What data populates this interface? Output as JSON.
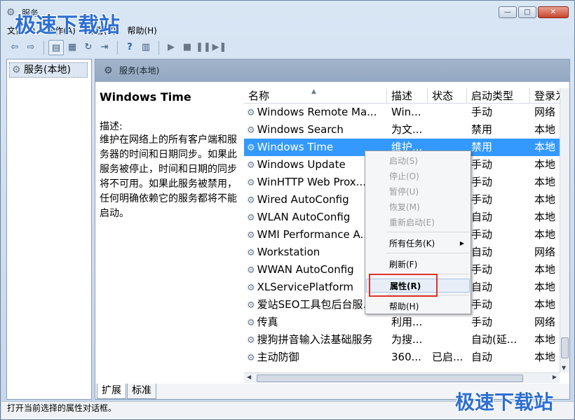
{
  "window": {
    "title": "服务",
    "app_icon": "⚙",
    "buttons": [
      "—",
      "□",
      "✕"
    ]
  },
  "menubar": [
    "文件(F)",
    "操作(A)",
    "查看(V)",
    "帮助(H)"
  ],
  "toolbar": {
    "icons": [
      "back-arrow-icon",
      "forward-arrow-icon",
      "show-hide-console-tree-icon",
      "properties-icon",
      "refresh-icon",
      "export-list-icon",
      "help-icon",
      "view-icon",
      "start-service-icon",
      "stop-service-icon",
      "pause-service-icon",
      "restart-service-icon"
    ]
  },
  "tree": {
    "item": "服务(本地)"
  },
  "pane": {
    "header": "服务(本地)"
  },
  "description": {
    "service_title": "Windows Time",
    "label": "描述:",
    "text": "维护在网络上的所有客户端和服务器的时间和日期同步。如果此服务被停止，时间和日期的同步将不可用。如果此服务被禁用，任何明确依赖它的服务都将不能启动。"
  },
  "columns": [
    "名称",
    "描述",
    "状态",
    "启动类型",
    "登录为"
  ],
  "rows": [
    {
      "name": "Windows Remote Ma...",
      "desc": "Win...",
      "status": "",
      "start": "手动",
      "logon": "网络"
    },
    {
      "name": "Windows Search",
      "desc": "为文...",
      "status": "",
      "start": "禁用",
      "logon": "本地"
    },
    {
      "name": "Windows Time",
      "desc": "维护...",
      "status": "",
      "start": "禁用",
      "logon": "本地"
    },
    {
      "name": "Windows Update",
      "desc": "",
      "status": "",
      "start": "手动",
      "logon": "本地"
    },
    {
      "name": "WinHTTP Web Prox...",
      "desc": "",
      "status": "",
      "start": "手动",
      "logon": "本地"
    },
    {
      "name": "Wired AutoConfig",
      "desc": "",
      "status": "",
      "start": "手动",
      "logon": "本地"
    },
    {
      "name": "WLAN AutoConfig",
      "desc": "",
      "status": "",
      "start": "自动",
      "logon": "本地"
    },
    {
      "name": "WMI Performance A...",
      "desc": "",
      "status": "",
      "start": "手动",
      "logon": "本地"
    },
    {
      "name": "Workstation",
      "desc": "",
      "status": "",
      "start": "自动",
      "logon": "网络"
    },
    {
      "name": "WWAN AutoConfig",
      "desc": "",
      "status": "",
      "start": "手动",
      "logon": "本地"
    },
    {
      "name": "XLServicePlatform",
      "desc": "",
      "status": "",
      "start": "自动",
      "logon": "本地"
    },
    {
      "name": "爱站SEO工具包后台服...",
      "desc": "",
      "status": "",
      "start": "手动",
      "logon": "本地"
    },
    {
      "name": "传真",
      "desc": "利用...",
      "status": "",
      "start": "手动",
      "logon": "网络"
    },
    {
      "name": "搜狗拼音输入法基础服务",
      "desc": "为搜...",
      "status": "",
      "start": "自动(延...",
      "logon": "本地"
    },
    {
      "name": "主动防御",
      "desc": "360...",
      "status": "已启...",
      "start": "自动",
      "logon": "本地"
    }
  ],
  "selected_row": 2,
  "context_menu": {
    "items": [
      {
        "label": "启动(S)",
        "disabled": true
      },
      {
        "label": "停止(O)",
        "disabled": true
      },
      {
        "label": "暂停(U)",
        "disabled": true
      },
      {
        "label": "恢复(M)",
        "disabled": true
      },
      {
        "label": "重新启动(E)",
        "disabled": true
      },
      {
        "label": "所有任务(K)",
        "disabled": false,
        "submenu": true
      },
      {
        "label": "刷新(F)",
        "disabled": false
      },
      {
        "label": "属性(R)",
        "disabled": false,
        "bold": true,
        "highlighted": true
      },
      {
        "label": "帮助(H)",
        "disabled": false
      }
    ]
  },
  "tabs": [
    "扩展",
    "标准"
  ],
  "statusbar": "打开当前选择的属性对话框。",
  "watermark": "极速下载站",
  "colors": {
    "selection": "#3399ff",
    "highlight_box": "#e0322a",
    "watermark": "#2e6fd1"
  }
}
